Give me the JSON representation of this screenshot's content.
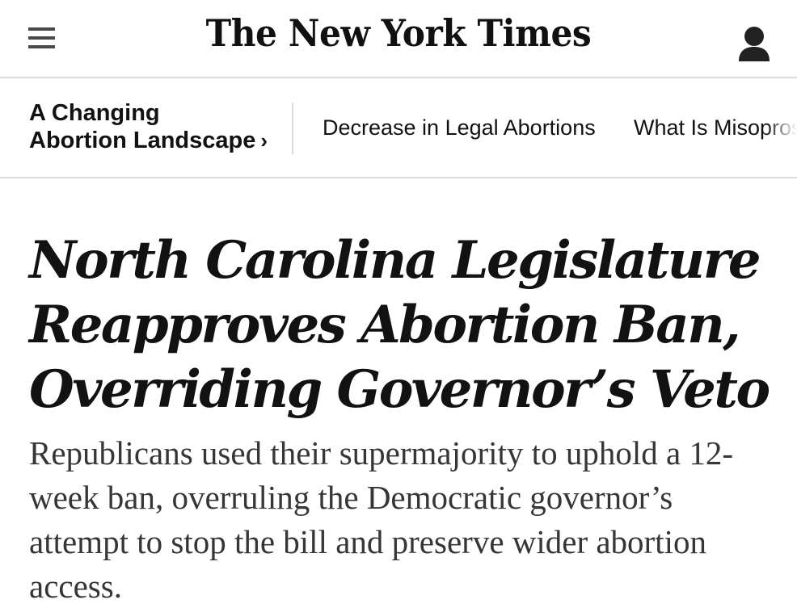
{
  "masthead": {
    "logo_text": "The New York Times",
    "menu_icon": "hamburger-menu-icon",
    "account_icon": "user-account-icon"
  },
  "subnav": {
    "section_label_line1": "A Changing",
    "section_label_line2": "Abortion Landscape",
    "section_chevron": "›",
    "links": [
      {
        "label": "Decrease in Legal Abortions"
      },
      {
        "label": "What Is Misopros"
      }
    ]
  },
  "article": {
    "headline": "North Carolina Legislature Reapproves Abortion Ban, Overriding Governor’s Veto",
    "summary": "Republicans used their supermajority to uphold a 12-week ban, overruling the Democratic governor’s attempt to stop the bill and preserve wider abortion access."
  },
  "colors": {
    "text": "#121212",
    "summary_text": "#363636",
    "divider": "#dcdcdc",
    "icon": "#4a4a4a"
  }
}
